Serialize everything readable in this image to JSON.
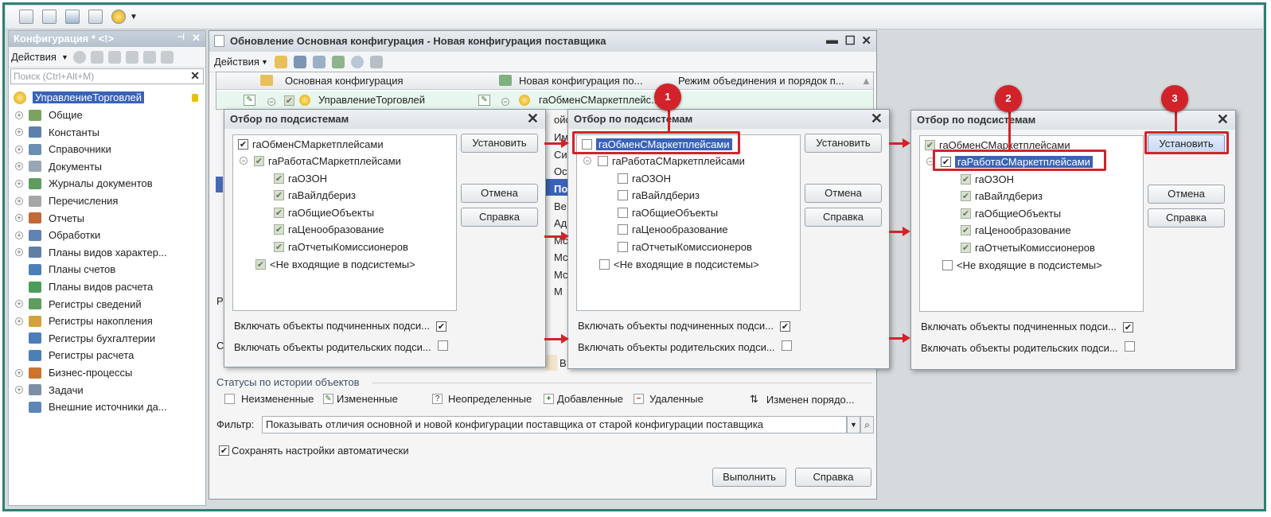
{
  "left_panel": {
    "title": "Конфигурация * <!>",
    "actions_label": "Действия",
    "search_placeholder": "Поиск (Ctrl+Alt+M)",
    "root": "УправлениеТорговлей",
    "items": [
      {
        "label": "Общие",
        "expandable": true,
        "icon": "shapes-icon"
      },
      {
        "label": "Константы",
        "expandable": true,
        "icon": "blocks-icon"
      },
      {
        "label": "Справочники",
        "expandable": true,
        "icon": "table-icon"
      },
      {
        "label": "Документы",
        "expandable": true,
        "icon": "document-icon"
      },
      {
        "label": "Журналы документов",
        "expandable": true,
        "icon": "journal-icon"
      },
      {
        "label": "Перечисления",
        "expandable": true,
        "icon": "enum-icon"
      },
      {
        "label": "Отчеты",
        "expandable": true,
        "icon": "report-icon"
      },
      {
        "label": "Обработки",
        "expandable": true,
        "icon": "processing-icon"
      },
      {
        "label": "Планы видов характер...",
        "expandable": true,
        "icon": "plan-icon"
      },
      {
        "label": "Планы счетов",
        "expandable": false,
        "icon": "accounts-icon"
      },
      {
        "label": "Планы видов расчета",
        "expandable": false,
        "icon": "calc-icon"
      },
      {
        "label": "Регистры сведений",
        "expandable": true,
        "icon": "register-icon"
      },
      {
        "label": "Регистры накопления",
        "expandable": true,
        "icon": "accum-icon"
      },
      {
        "label": "Регистры бухгалтерии",
        "expandable": false,
        "icon": "accounting-icon"
      },
      {
        "label": "Регистры расчета",
        "expandable": false,
        "icon": "calcreg-icon"
      },
      {
        "label": "Бизнес-процессы",
        "expandable": true,
        "icon": "process-icon"
      },
      {
        "label": "Задачи",
        "expandable": true,
        "icon": "task-icon"
      },
      {
        "label": "Внешние источники да...",
        "expandable": false,
        "icon": "external-icon"
      }
    ]
  },
  "main_window": {
    "title": "Обновление Основная конфигурация - Новая конфигурация поставщика",
    "actions_label": "Действия",
    "columns": [
      "Основная конфигурация",
      "Новая конфигурация по...",
      "Режим объединения и порядок п..."
    ],
    "row": {
      "main": "УправлениеТорговлей",
      "new": "гаОбменСМаркетплейс..."
    },
    "side_fragments": [
      "ойс",
      "Им",
      "Си",
      "Ос",
      "По",
      "Ве",
      "Ад",
      "Мс",
      "Мс",
      "Мс",
      "М"
    ],
    "left_fragments": [
      "Р",
      "С"
    ],
    "status_title": "Статусы по истории объектов",
    "statuses": [
      "Неизмененные",
      "Измененные",
      "Неопределенные",
      "Добавленные",
      "Удаленные",
      "Изменен порядо..."
    ],
    "filter_label": "Фильтр:",
    "filter_value": "Показывать отличия основной и новой конфигурации поставщика от старой конфигурации поставщика",
    "autosave_label": "Сохранять настройки автоматически",
    "execute_label": "Выполнить",
    "help_label": "Справка",
    "b_fragment": "В"
  },
  "dialog": {
    "title": "Отбор по подсистемам",
    "set_label": "Установить",
    "cancel_label": "Отмена",
    "help_label": "Справка",
    "include_sub": "Включать объекты подчиненных подси...",
    "include_parent": "Включать объекты родительских подси...",
    "root": "гаОбменСМаркетплейсами",
    "child": "гаРаботаСМаркетплейсами",
    "leaves": [
      "гаОЗОН",
      "гаВайлдбериз",
      "гаОбщиеОбъекты",
      "гаЦенообразование",
      "гаОтчетыКомиссионеров"
    ],
    "not_included": "<Не входящие в подсистемы>"
  },
  "badges": [
    "1",
    "2",
    "3"
  ],
  "colors": {
    "accent_red": "#d2232a",
    "selection": "#3a63b8",
    "frame": "#2f7f76"
  }
}
